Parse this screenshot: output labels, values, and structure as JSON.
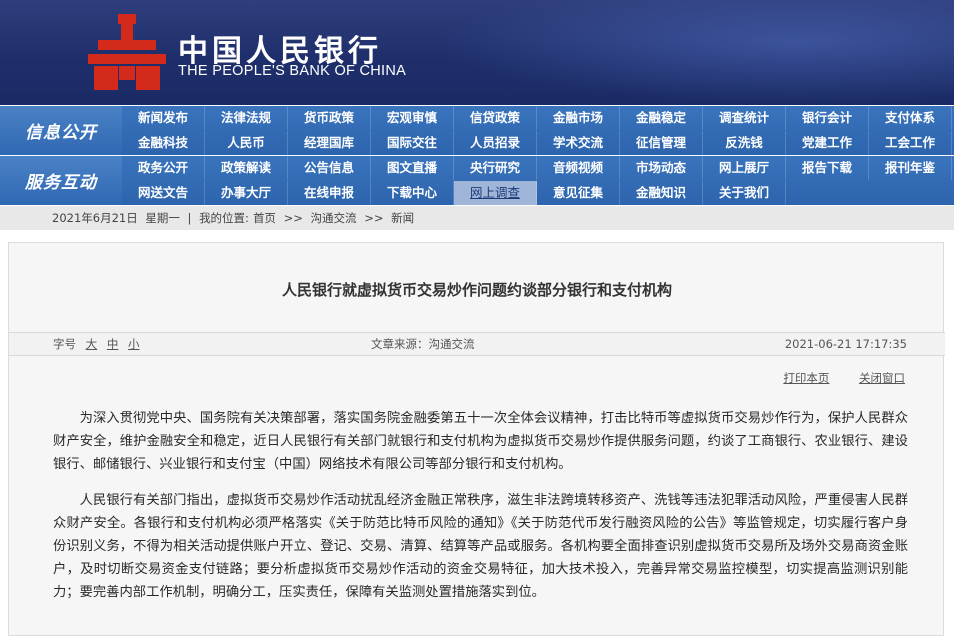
{
  "header": {
    "bank_name_cn": "中国人民银行",
    "bank_name_en": "THE PEOPLE'S BANK OF CHINA",
    "logo_icon": "pboc-logo-icon",
    "logo_color": "#d42a1c"
  },
  "nav": {
    "disclosure": {
      "label": "信息公开",
      "row1": [
        "新闻发布",
        "法律法规",
        "货币政策",
        "宏观审慎",
        "信贷政策",
        "金融市场",
        "金融稳定",
        "调查统计",
        "银行会计",
        "支付体系"
      ],
      "row2": [
        "金融科技",
        "人民币",
        "经理国库",
        "国际交往",
        "人员招录",
        "学术交流",
        "征信管理",
        "反洗钱",
        "党建工作",
        "工会工作"
      ]
    },
    "interaction": {
      "label": "服务互动",
      "row1": [
        "政务公开",
        "政策解读",
        "公告信息",
        "图文直播",
        "央行研究",
        "音频视频",
        "市场动态",
        "网上展厅",
        "报告下载",
        "报刊年鉴"
      ],
      "row2": [
        "网送文告",
        "办事大厅",
        "在线申报",
        "下载中心",
        "网上调查",
        "意见征集",
        "金融知识",
        "关于我们"
      ]
    },
    "active_item": "网上调查"
  },
  "breadcrumb": {
    "date": "2021年6月21日",
    "weekday": "星期一",
    "sep": "|",
    "location_label": "我的位置:",
    "home": "首页",
    "arrow": ">>",
    "level1": "沟通交流",
    "level2": "新闻"
  },
  "article": {
    "title": "人民银行就虚拟货币交易炒作问题约谈部分银行和支付机构",
    "font_size_label": "字号",
    "font_sizes": [
      "大",
      "中",
      "小"
    ],
    "source": "文章来源：沟通交流",
    "datetime": "2021-06-21  17:17:35",
    "print_label": "打印本页",
    "close_label": "关闭窗口",
    "paragraphs": [
      "为深入贯彻党中央、国务院有关决策部署，落实国务院金融委第五十一次全体会议精神，打击比特币等虚拟货币交易炒作行为，保护人民群众财产安全，维护金融安全和稳定，近日人民银行有关部门就银行和支付机构为虚拟货币交易炒作提供服务问题，约谈了工商银行、农业银行、建设银行、邮储银行、兴业银行和支付宝（中国）网络技术有限公司等部分银行和支付机构。",
      "人民银行有关部门指出，虚拟货币交易炒作活动扰乱经济金融正常秩序，滋生非法跨境转移资产、洗钱等违法犯罪活动风险，严重侵害人民群众财产安全。各银行和支付机构必须严格落实《关于防范比特币风险的通知》《关于防范代币发行融资风险的公告》等监管规定，切实履行客户身份识别义务，不得为相关活动提供账户开立、登记、交易、清算、结算等产品或服务。各机构要全面排查识别虚拟货币交易所及场外交易商资金账户，及时切断交易资金支付链路；要分析虚拟货币交易炒作活动的资金交易特征，加大技术投入，完善异常交易监控模型，切实提高监测识别能力；要完善内部工作机制，明确分工，压实责任，保障有关监测处置措施落实到位。"
    ]
  }
}
